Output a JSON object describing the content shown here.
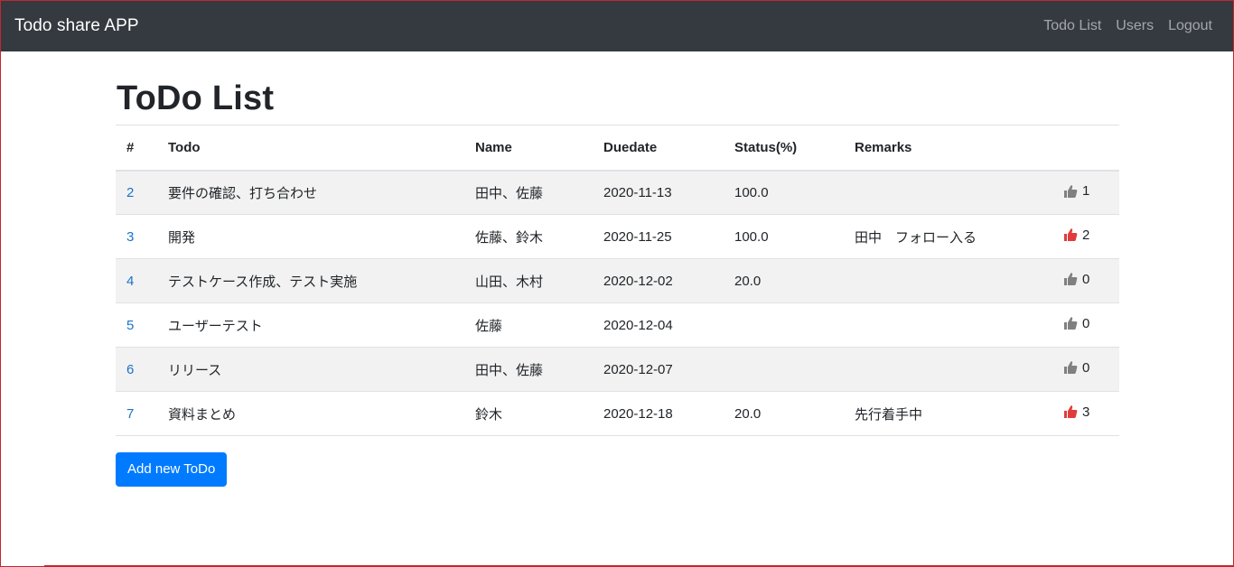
{
  "navbar": {
    "brand": "Todo share APP",
    "links": [
      "Todo List",
      "Users",
      "Logout"
    ]
  },
  "page": {
    "title": "ToDo List",
    "add_button": "Add new ToDo"
  },
  "table": {
    "headers": [
      "#",
      "Todo",
      "Name",
      "Duedate",
      "Status(%)",
      "Remarks",
      ""
    ],
    "rows": [
      {
        "id": "2",
        "todo": "要件の確認、打ち合わせ",
        "name": "田中、佐藤",
        "duedate": "2020-11-13",
        "status": "100.0",
        "remarks": "",
        "likes": "1",
        "liked": false
      },
      {
        "id": "3",
        "todo": "開発",
        "name": "佐藤、鈴木",
        "duedate": "2020-11-25",
        "status": "100.0",
        "remarks": "田中　フォロー入る",
        "likes": "2",
        "liked": true
      },
      {
        "id": "4",
        "todo": "テストケース作成、テスト実施",
        "name": "山田、木村",
        "duedate": "2020-12-02",
        "status": "20.0",
        "remarks": "",
        "likes": "0",
        "liked": false
      },
      {
        "id": "5",
        "todo": "ユーザーテスト",
        "name": "佐藤",
        "duedate": "2020-12-04",
        "status": "",
        "remarks": "",
        "likes": "0",
        "liked": false
      },
      {
        "id": "6",
        "todo": "リリース",
        "name": "田中、佐藤",
        "duedate": "2020-12-07",
        "status": "",
        "remarks": "",
        "likes": "0",
        "liked": false
      },
      {
        "id": "7",
        "todo": "資料まとめ",
        "name": "鈴木",
        "duedate": "2020-12-18",
        "status": "20.0",
        "remarks": "先行着手中",
        "likes": "3",
        "liked": true
      }
    ]
  },
  "colors": {
    "navbar_bg": "#343a40",
    "link": "#1a73c8",
    "button": "#007bff",
    "like_active": "#e03c3c",
    "like_inactive": "#808080",
    "stripe": "#f2f2f2"
  },
  "icons": {
    "like": "thumbs-up-icon"
  }
}
